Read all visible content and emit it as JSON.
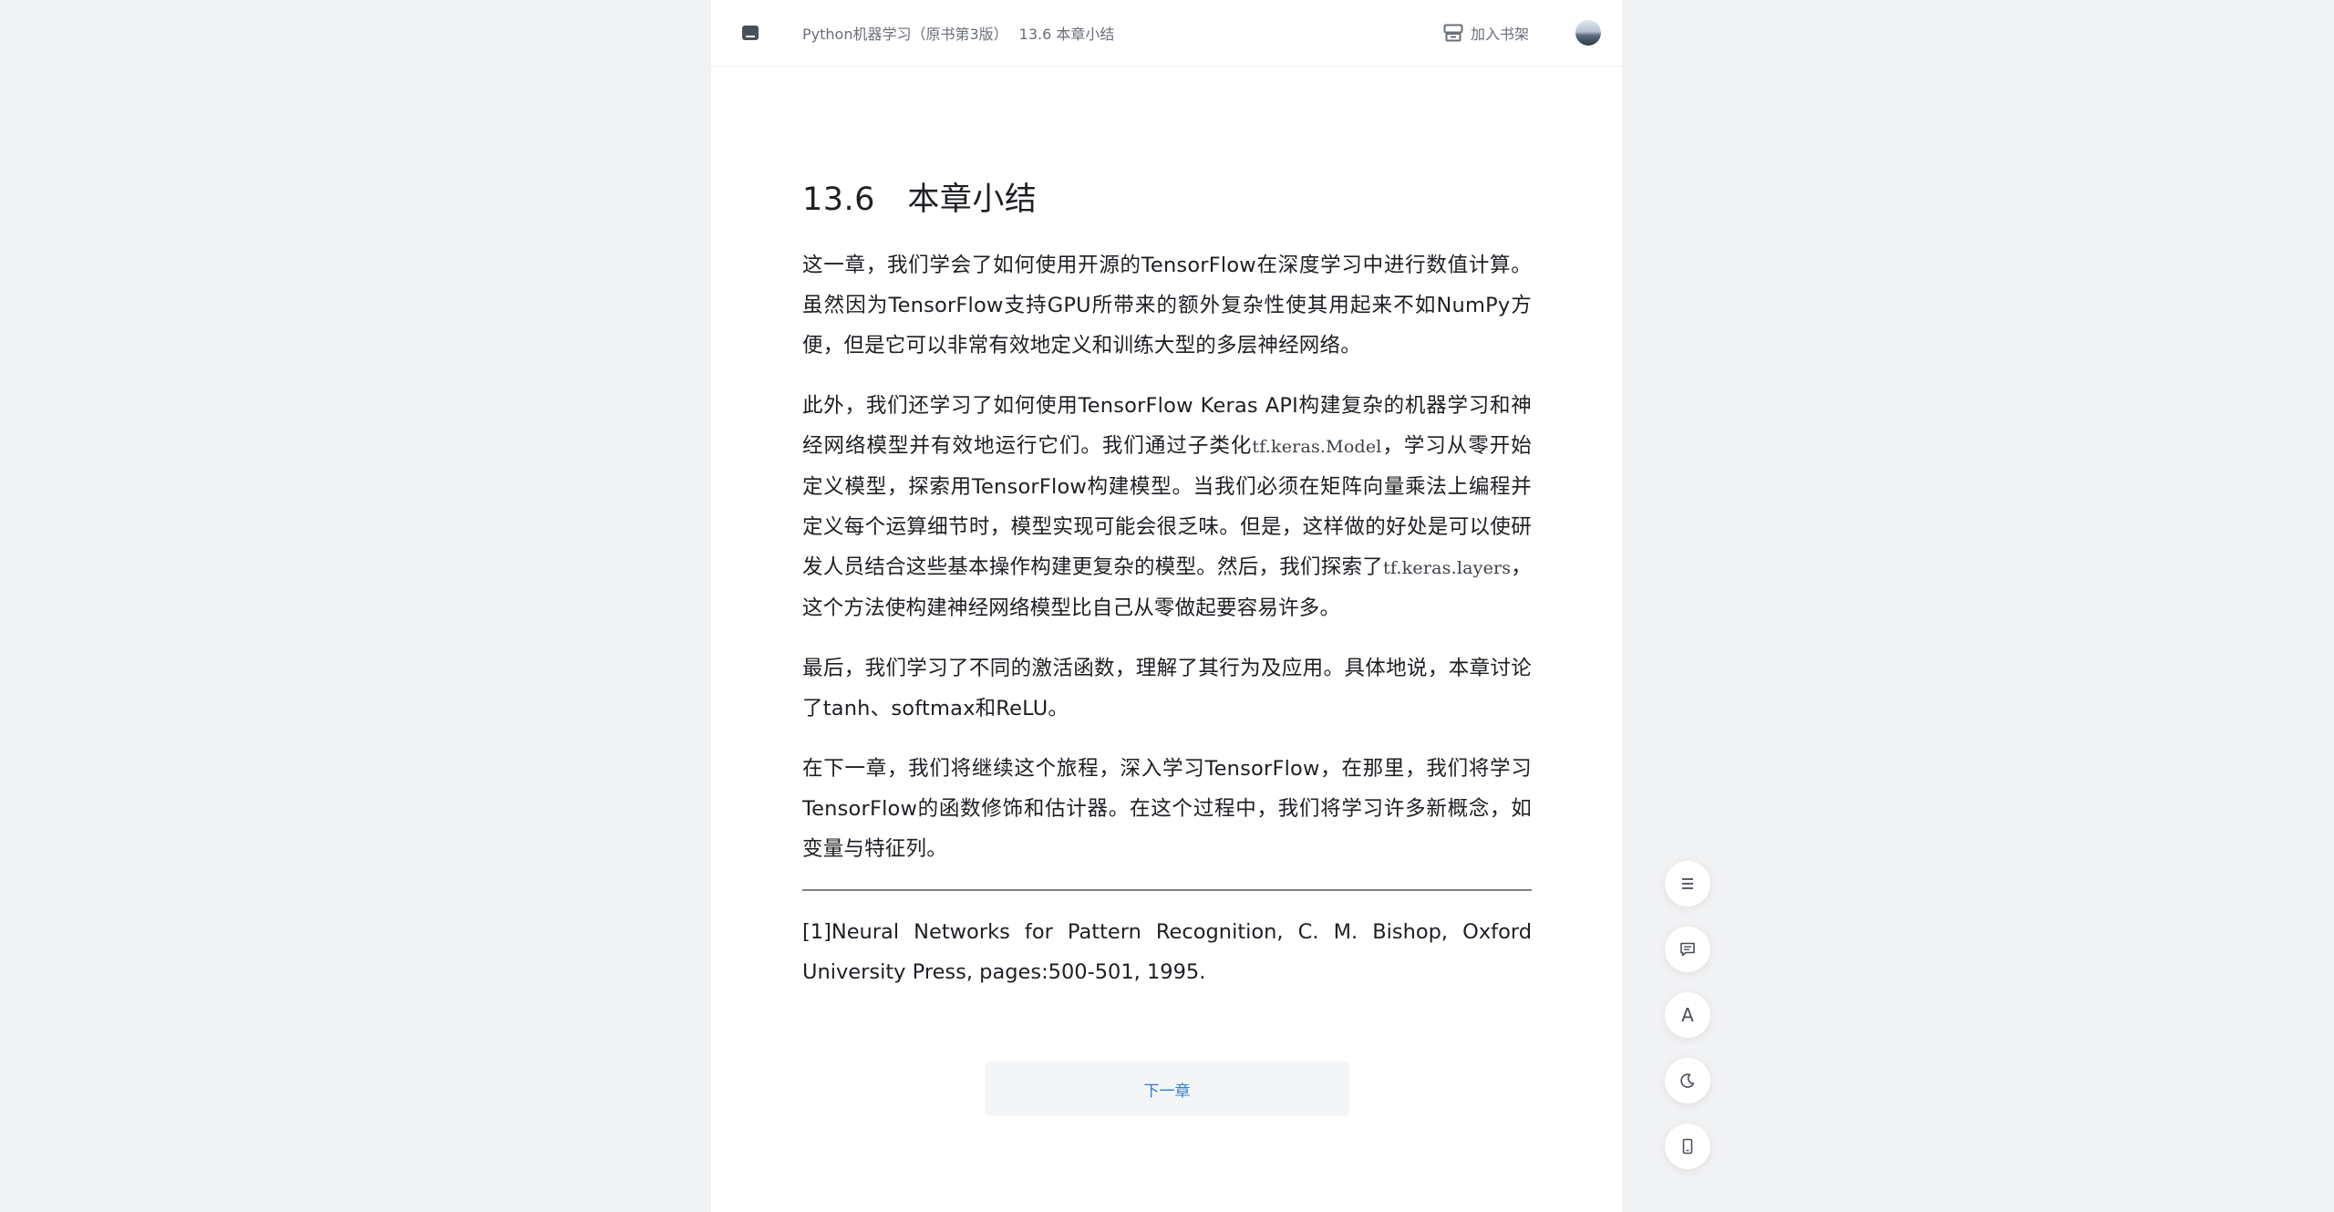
{
  "header": {
    "book_title": "Python机器学习（原书第3版）",
    "section_title": "13.6 本章小结",
    "add_shelf_label": "加入书架"
  },
  "chapter": {
    "title": "13.6　本章小结",
    "p1": "这一章，我们学会了如何使用开源的TensorFlow在深度学习中进行数值计算。虽然因为TensorFlow支持GPU所带来的额外复杂性使其用起来不如NumPy方便，但是它可以非常有效地定义和训练大型的多层神经网络。",
    "p2_a": "此外，我们还学习了如何使用TensorFlow Keras API构建复杂的机器学习和神经网络模型并有效地运行它们。我们通过子类化",
    "p2_code1": "tf.keras.Model",
    "p2_b": "，学习从零开始定义模型，探索用TensorFlow构建模型。当我们必须在矩阵向量乘法上编程并定义每个运算细节时，模型实现可能会很乏味。但是，这样做的好处是可以使研发人员结合这些基本操作构建更复杂的模型。然后，我们探索了",
    "p2_code2": "tf.keras.layers",
    "p2_c": "，这个方法使构建神经网络模型比自己从零做起要容易许多。",
    "p3": "最后，我们学习了不同的激活函数，理解了其行为及应用。具体地说，本章讨论了tanh、softmax和ReLU。",
    "p4": "在下一章，我们将继续这个旅程，深入学习TensorFlow，在那里，我们将学习TensorFlow的函数修饰和估计器。在这个过程中，我们将学习许多新概念，如变量与特征列。",
    "footnote": "[1]Neural Networks for Pattern Recognition, C. M. Bishop, Oxford University Press, pages:500-501, 1995."
  },
  "next_chapter_label": "下一章",
  "side_tools": {
    "toc": "menu-icon",
    "notes": "comment-icon",
    "font": "A",
    "theme": "moon-icon",
    "mobile": "phone-icon"
  },
  "colors": {
    "accent": "#2a7de1",
    "background": "#f1f2f4",
    "page": "#ffffff"
  }
}
